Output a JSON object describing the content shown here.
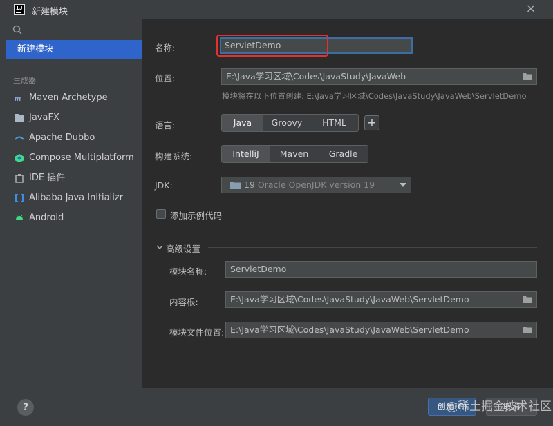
{
  "window": {
    "title": "新建模块",
    "close_glyph": "×"
  },
  "sidebar": {
    "selected": "新建模块",
    "section_label": "生成器",
    "items": [
      {
        "label": "Maven Archetype",
        "icon": "maven-icon"
      },
      {
        "label": "JavaFX",
        "icon": "javafx-icon"
      },
      {
        "label": "Apache Dubbo",
        "icon": "dubbo-icon"
      },
      {
        "label": "Compose Multiplatform",
        "icon": "compose-icon"
      },
      {
        "label": "IDE 插件",
        "icon": "ide-plugin-icon"
      },
      {
        "label": "Alibaba Java Initializr",
        "icon": "alibaba-icon"
      },
      {
        "label": "Android",
        "icon": "android-icon"
      }
    ],
    "help_glyph": "?"
  },
  "form": {
    "name_label": "名称:",
    "name_value": "ServletDemo",
    "location_label": "位置:",
    "location_value": "E:\\Java学习区域\\Codes\\JavaStudy\\JavaWeb",
    "location_hint": "模块将在以下位置创建: E:\\Java学习区域\\Codes\\JavaStudy\\JavaWeb\\ServletDemo",
    "language_label": "语言:",
    "languages": [
      "Java",
      "Groovy",
      "HTML"
    ],
    "language_selected": "Java",
    "add_glyph": "+",
    "build_label": "构建系统:",
    "build_systems": [
      "IntelliJ",
      "Maven",
      "Gradle"
    ],
    "build_selected": "IntelliJ",
    "jdk_label": "JDK:",
    "jdk_version": "19",
    "jdk_name": "Oracle OpenJDK version 19",
    "sample_code_label": "添加示例代码",
    "sample_code_checked": false
  },
  "advanced": {
    "title": "高级设置",
    "expanded": true,
    "module_name_label": "模块名称:",
    "module_name_value": "ServletDemo",
    "content_root_label": "内容根:",
    "content_root_value": "E:\\Java学习区域\\Codes\\JavaStudy\\JavaWeb\\ServletDemo",
    "module_file_label": "模块文件位置:",
    "module_file_value": "E:\\Java学习区域\\Codes\\JavaStudy\\JavaWeb\\ServletDemo"
  },
  "footer": {
    "create_label": "创建(C)",
    "cancel_label": "取消",
    "watermark": "@稀土掘金技术社区"
  },
  "colors": {
    "accent": "#2f65ca",
    "highlight_box": "#e53030",
    "focus_border": "#3d6ea3"
  }
}
